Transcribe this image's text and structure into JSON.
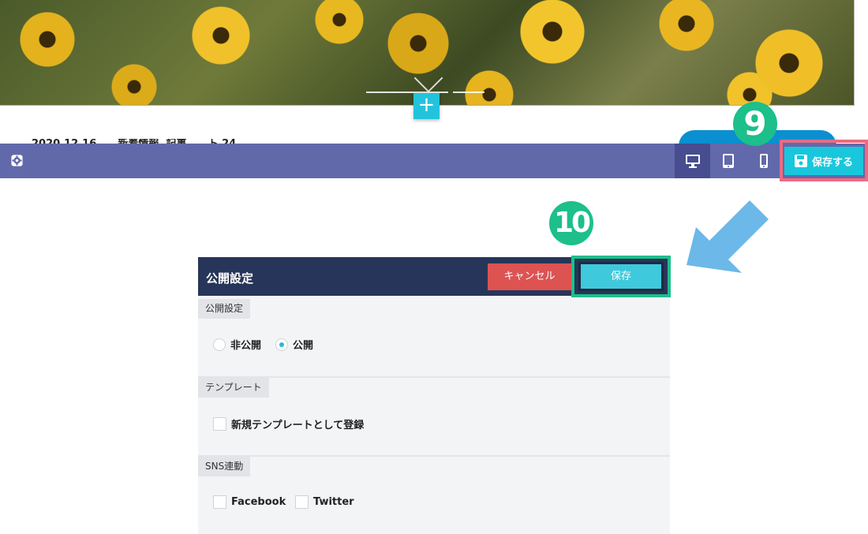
{
  "hero": {
    "image": "sunflower-photo"
  },
  "add_section": {
    "label": "+"
  },
  "underlay": {
    "cut_text": "2020.12.16      新着情報  記事      ト 24"
  },
  "toolbar": {
    "settings_icon": "gear-icon",
    "devices": [
      "desktop-icon",
      "tablet-icon",
      "mobile-icon"
    ],
    "save_label": "保存する"
  },
  "annotations": {
    "step_9": "9",
    "step_10": "10"
  },
  "modal": {
    "title": "公開設定",
    "cancel_label": "キャンセル",
    "save_label": "保存",
    "sections": {
      "publish": {
        "label": "公開設定",
        "options": [
          {
            "label": "非公開",
            "selected": false
          },
          {
            "label": "公開",
            "selected": true
          }
        ]
      },
      "template": {
        "label": "テンプレート",
        "option": {
          "label": "新規テンプレートとして登録",
          "checked": false
        }
      },
      "sns": {
        "label": "SNS連動",
        "options": [
          {
            "label": "Facebook",
            "checked": false
          },
          {
            "label": "Twitter",
            "checked": false
          }
        ]
      }
    }
  },
  "colors": {
    "toolbar": "#6269ab",
    "toolbar_active": "#474d8f",
    "save_button": "#19c7dc",
    "save_highlight": "#ee6a82",
    "step_badge": "#1dbf8a",
    "arrow": "#6cb8e8",
    "modal_header": "#27355a",
    "cancel_button": "#dc5352"
  }
}
